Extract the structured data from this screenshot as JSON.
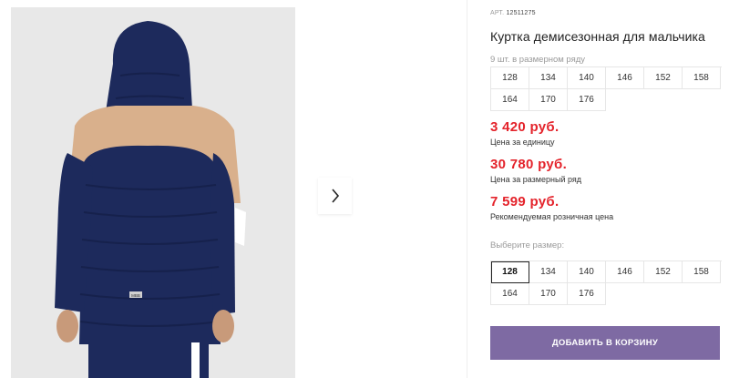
{
  "product": {
    "sku_label": "АРТ.",
    "sku_value": "12511275",
    "title": "Куртка демисезонная для мальчика"
  },
  "series": {
    "caption": "9 шт. в размерном ряду",
    "sizes": [
      "128",
      "134",
      "140",
      "146",
      "152",
      "158",
      "164",
      "170",
      "176"
    ]
  },
  "prices": [
    {
      "amount": "3 420 руб.",
      "label": "Цена за единицу"
    },
    {
      "amount": "30 780 руб.",
      "label": "Цена за размерный ряд"
    },
    {
      "amount": "7 599 руб.",
      "label": "Рекомендуемая розничная цена"
    }
  ],
  "size_select": {
    "label": "Выберите размер:",
    "sizes": [
      "128",
      "134",
      "140",
      "146",
      "152",
      "158",
      "164",
      "170",
      "176"
    ],
    "selected": "128"
  },
  "cart_button": {
    "label": "ДОБАВИТЬ В КОРЗИНУ",
    "color": "#7e6aa3"
  },
  "photo": {
    "jacket_tag": "MBB"
  },
  "colors": {
    "price": "#e4232b",
    "accent": "#7e6aa3",
    "jacket_navy": "#1d2a5c",
    "jacket_beige": "#d9b08c"
  },
  "icons": {
    "next": "chevron-right-icon"
  }
}
